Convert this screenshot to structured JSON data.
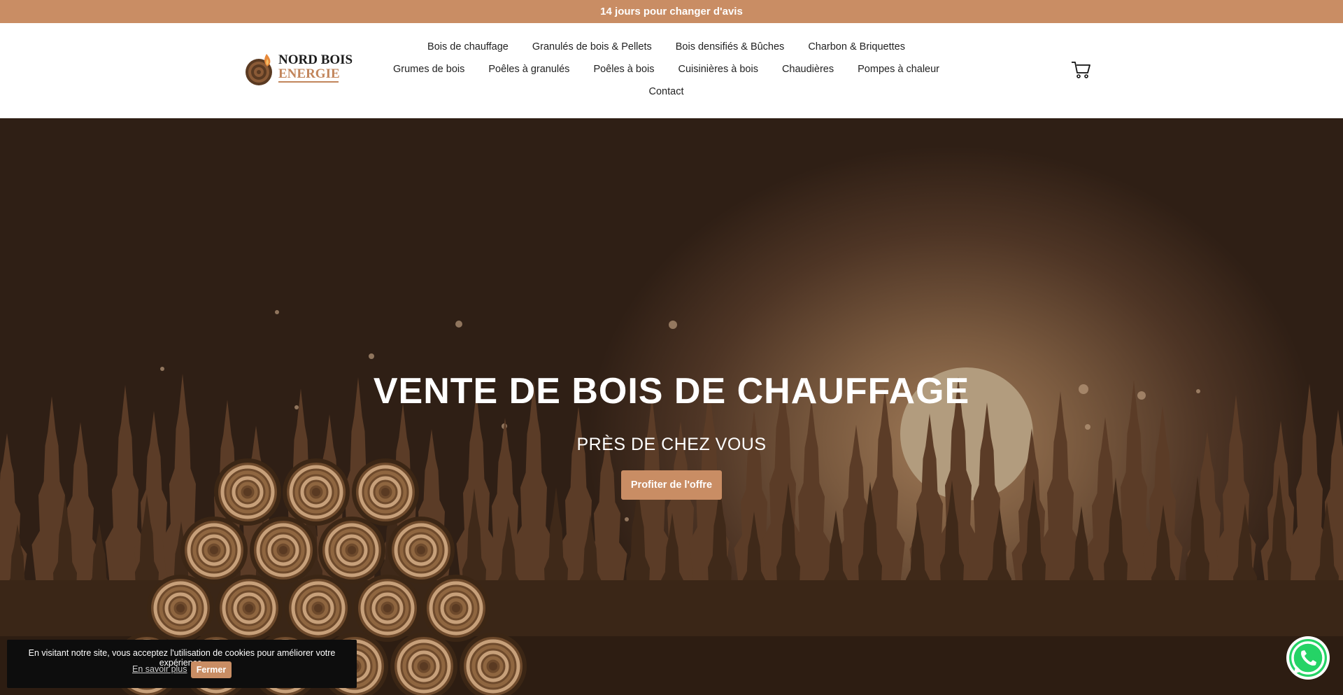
{
  "announcement": {
    "text": "14 jours pour changer d'avis"
  },
  "logo": {
    "line1": "NORD BOIS",
    "line2": "ENERGIE"
  },
  "nav": {
    "row1": [
      "Bois de chauffage",
      "Granulés de bois & Pellets",
      "Bois densifiés & Bûches",
      "Charbon & Briquettes"
    ],
    "row2": [
      "Grumes de bois",
      "Poêles à granulés",
      "Poêles à bois",
      "Cuisinières à bois",
      "Chaudières",
      "Pompes à chaleur"
    ],
    "row3": [
      "Contact"
    ]
  },
  "hero": {
    "title": "VENTE DE BOIS DE CHAUFFAGE",
    "subtitle": "PRÈS DE CHEZ VOUS",
    "cta": "Profiter de l'offre"
  },
  "cookie": {
    "text": "En visitant notre site, vous acceptez l'utilisation de cookies pour améliorer votre expérience.",
    "more": "En savoir plus",
    "close": "Fermer"
  },
  "colors": {
    "accent": "#c98d64",
    "header_bg": "#ffffff",
    "hero_dark": "#2f1f15"
  },
  "icons": {
    "cart": "cart-icon",
    "whatsapp": "whatsapp-icon",
    "logo": "wood-log-flame-icon"
  }
}
